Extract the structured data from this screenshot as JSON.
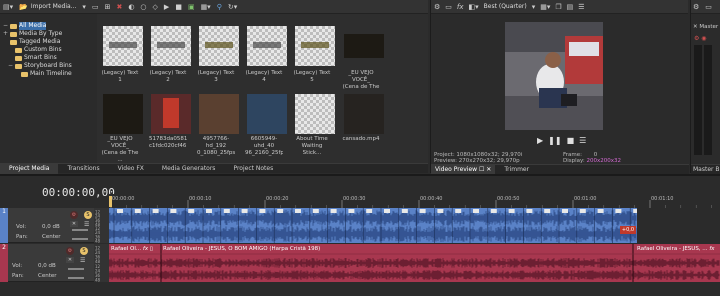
{
  "media_toolbar": {
    "import_label": "Import Media..."
  },
  "tree": [
    {
      "label": "All Media",
      "mark": "−",
      "sel": true
    },
    {
      "label": "Media By Type",
      "mark": "+",
      "sel": false
    },
    {
      "label": "Tagged Media",
      "mark": "",
      "sel": false
    },
    {
      "label": "Custom Bins",
      "mark": "",
      "sel": false
    },
    {
      "label": "Smart Bins",
      "mark": "",
      "sel": false
    },
    {
      "label": "Storyboard Bins",
      "mark": "−",
      "sel": false
    },
    {
      "label": "Main Timeline",
      "mark": "",
      "sel": false
    }
  ],
  "media_items": [
    {
      "title": "(Legacy) Text 1",
      "sub": "",
      "kind": "legacy"
    },
    {
      "title": "(Legacy) Text 2",
      "sub": "",
      "kind": "legacy"
    },
    {
      "title": "(Legacy) Text 3",
      "sub": "",
      "kind": "legacy-yellow"
    },
    {
      "title": "(Legacy) Text 4",
      "sub": "",
      "kind": "legacy"
    },
    {
      "title": "(Legacy) Text 5",
      "sub": "",
      "kind": "legacy-yellow"
    },
    {
      "title": "_EU VEJO VOCÊ_",
      "sub": "(Cena de The ...",
      "kind": "video-dark"
    },
    {
      "title": "_EU VEJO VOCÊ_",
      "sub": "(Cena de The ...",
      "kind": "video-dark"
    },
    {
      "title": "51783da0581478",
      "sub": "c1fdc020cf461...",
      "kind": "video-red"
    },
    {
      "title": "4957766-hd_192",
      "sub": "0_1080_25fps...",
      "kind": "video-brown"
    },
    {
      "title": "6605949-uhd_40",
      "sub": "96_2160_25fps...",
      "kind": "video-blue"
    },
    {
      "title": "About Time",
      "sub": "Waiting Stick...",
      "kind": "checker"
    },
    {
      "title": "cansado.mp4",
      "sub": "",
      "kind": "video-dark2"
    }
  ],
  "left_tabs": [
    "Project Media",
    "Transitions",
    "Video FX",
    "Media Generators",
    "Project Notes"
  ],
  "preview": {
    "quality": "Best (Quarter)",
    "project_label": "Project:",
    "project_value": "1080x1080x32; 29,970i",
    "preview_label": "Preview:",
    "preview_value": "270x270x32; 29,970p",
    "frame_label": "Frame:",
    "frame_value": "0",
    "display_label": "Display:",
    "display_value": "200x200x32",
    "tabs": [
      "Video Preview",
      "Trimmer"
    ]
  },
  "master": {
    "label": "Master",
    "bus_tab": "Master Bu"
  },
  "timecode": "00:00:00,00",
  "ruler": [
    "00:00:00",
    "00:00:10",
    "00:00:20",
    "00:00:30",
    "00:00:40",
    "00:00:50",
    "00:01:00",
    "00:01:10"
  ],
  "track1": {
    "num": "1",
    "vol_label": "Vol:",
    "vol_value": "0,0 dB",
    "pan_label": "Pan:",
    "pan_value": "Center",
    "db_marks": [
      "12",
      "24",
      "36",
      "48",
      "12",
      "24",
      "36",
      "48"
    ],
    "end_badge": "+0,0"
  },
  "track2": {
    "num": "2",
    "vol_label": "Vol:",
    "vol_value": "0,0 dB",
    "pan_label": "Pan:",
    "pan_value": "Center",
    "db_marks": [
      "12",
      "24",
      "36",
      "48",
      "12",
      "24",
      "36",
      "48"
    ],
    "clips": [
      {
        "label": "Rafael Ol...",
        "fx": "fx"
      },
      {
        "label": "Rafael Oliveira - JESUS, O BOM AMIGO (Harpa Cristã 198)",
        "fx": ""
      },
      {
        "label": "Rafael Oliveira - JESUS, ...",
        "fx": "fx"
      }
    ]
  },
  "colors": {
    "accent": "#3b6ea8",
    "video_track": "#5a82c7",
    "audio_track": "#a8374f",
    "display_val": "#d46ad2",
    "mute": "#c0392b"
  }
}
